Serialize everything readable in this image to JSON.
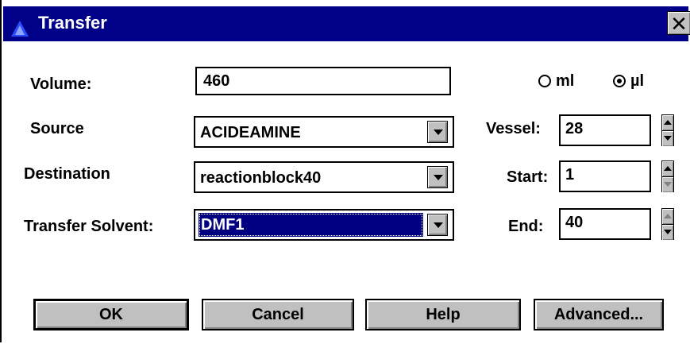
{
  "window": {
    "title": "Transfer",
    "close_label": "✕"
  },
  "volume": {
    "label": "Volume:",
    "value": "460"
  },
  "units": {
    "ml_label": "ml",
    "ul_label": "µl",
    "selected": "µl"
  },
  "source": {
    "label": "Source",
    "value": "ACIDEAMINE"
  },
  "destination": {
    "label": "Destination",
    "value": "reactionblock40"
  },
  "transfer_solvent": {
    "label": "Transfer Solvent:",
    "value": "DMF1"
  },
  "vessel": {
    "label": "Vessel:",
    "value": "28"
  },
  "start": {
    "label": "Start:",
    "value": "1"
  },
  "end": {
    "label": "End:",
    "value": "40"
  },
  "buttons": {
    "ok": "OK",
    "cancel": "Cancel",
    "help": "Help",
    "advanced": "Advanced..."
  },
  "colors": {
    "titlebar": "#000088",
    "face": "#c0c0c0",
    "highlight": "#000080"
  }
}
